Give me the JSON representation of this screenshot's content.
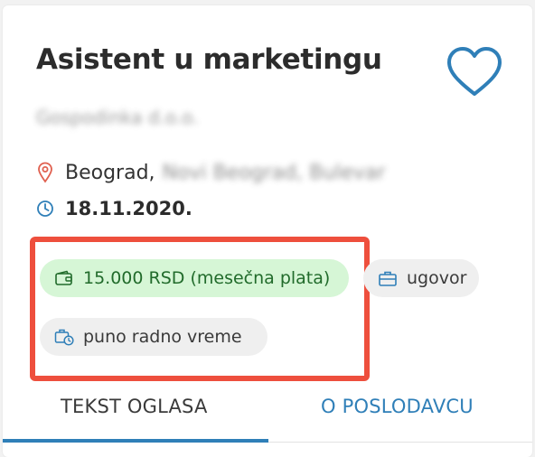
{
  "job": {
    "title": "Asistent u marketingu",
    "company": "Gospodinka d.o.o.",
    "location_city": "Beograd,",
    "location_rest": "Novi Beograd, Bulevar",
    "date": "18.11.2020."
  },
  "tags": {
    "salary": "15.000 RSD (mesečna plata)",
    "contract": "ugovor",
    "hours": "puno radno vreme"
  },
  "tabs": [
    {
      "label": "TEKST OGLASA",
      "active": true
    },
    {
      "label": "O POSLODAVCU",
      "active": false
    }
  ],
  "colors": {
    "accent": "#2f7fb8",
    "salary_bg": "#d6f6d6",
    "salary_text": "#216b2b",
    "highlight_border": "#ee4f3d",
    "pin": "#e0604f"
  },
  "icons": {
    "favorite": "heart-icon",
    "location": "map-pin-icon",
    "date": "clock-icon",
    "salary": "wallet-icon",
    "contract": "briefcase-icon",
    "hours": "briefcase-clock-icon"
  }
}
